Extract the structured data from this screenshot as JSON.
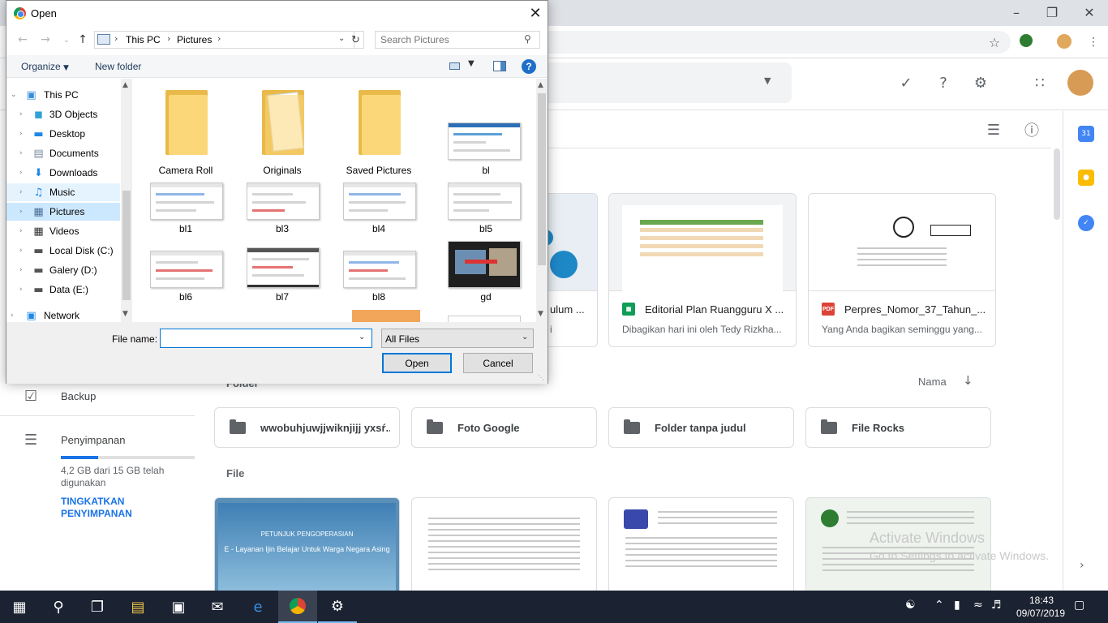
{
  "dialog": {
    "title": "Open",
    "breadcrumbs": [
      "This PC",
      "Pictures"
    ],
    "search_placeholder": "Search Pictures",
    "organize_label": "Organize",
    "new_folder_label": "New folder",
    "help_label": "?",
    "nav_tree": [
      {
        "label": "This PC",
        "icon": "monitor-icon",
        "expanded": true
      },
      {
        "label": "3D Objects",
        "icon": "cube-icon"
      },
      {
        "label": "Desktop",
        "icon": "desktop-icon"
      },
      {
        "label": "Documents",
        "icon": "documents-icon"
      },
      {
        "label": "Downloads",
        "icon": "download-arrow-icon"
      },
      {
        "label": "Music",
        "icon": "music-note-icon"
      },
      {
        "label": "Pictures",
        "icon": "pictures-icon",
        "selected": true
      },
      {
        "label": "Videos",
        "icon": "film-icon"
      },
      {
        "label": "Local Disk (C:)",
        "icon": "drive-icon"
      },
      {
        "label": "Galery (D:)",
        "icon": "drive-icon"
      },
      {
        "label": "Data (E:)",
        "icon": "drive-icon"
      },
      {
        "label": "Network",
        "icon": "network-icon"
      }
    ],
    "files": [
      {
        "name": "Camera Roll",
        "kind": "folder"
      },
      {
        "name": "Originals",
        "kind": "folder"
      },
      {
        "name": "Saved Pictures",
        "kind": "folder"
      },
      {
        "name": "bl",
        "kind": "image"
      },
      {
        "name": "bl1",
        "kind": "image"
      },
      {
        "name": "bl3",
        "kind": "image"
      },
      {
        "name": "bl4",
        "kind": "image"
      },
      {
        "name": "bl5",
        "kind": "image"
      },
      {
        "name": "bl6",
        "kind": "image"
      },
      {
        "name": "bl7",
        "kind": "image"
      },
      {
        "name": "bl8",
        "kind": "image"
      },
      {
        "name": "gd",
        "kind": "image"
      }
    ],
    "file_name_label": "File name:",
    "file_name_value": "",
    "file_type_value": "All Files",
    "open_label": "Open",
    "cancel_label": "Cancel"
  },
  "drive": {
    "quick_cards": [
      {
        "title": "ulum ...",
        "subtitle": "i",
        "type": ""
      },
      {
        "title": "Editorial Plan Ruangguru X ...",
        "subtitle": "Dibagikan hari ini oleh Tedy Rizkha...",
        "type": "sheets",
        "color": "#0f9d58"
      },
      {
        "title": "Perpres_Nomor_37_Tahun_...",
        "subtitle": "Yang Anda bagikan seminggu yang...",
        "type": "PDF",
        "color": "#db4437"
      }
    ],
    "folder_section_label": "Folder",
    "sort_label": "Nama",
    "folders": [
      "wwobuhjuwjjwiknjijj yxsŕ...",
      "Foto Google",
      "Folder tanpa judul",
      "File Rocks"
    ],
    "file_section_label": "File",
    "sidebar": {
      "backup_label": "Backup",
      "storage_label": "Penyimpanan",
      "storage_text": "4,2 GB dari 15 GB telah digunakan",
      "storage_fraction": 0.28,
      "upgrade_label": "TINGKATKAN PENYIMPANAN"
    },
    "file_card_texts": [
      "PETUNJUK PENGOPERASIAN",
      "E - Layanan Ijin Belajar Untuk Warga Negara Asing"
    ]
  },
  "watermark": {
    "line1": "Activate Windows",
    "line2": "Go to Settings to activate Windows."
  },
  "taskbar": {
    "time": "18:43",
    "date": "09/07/2019"
  },
  "colors": {
    "accent": "#1a73e8",
    "dialog_selection": "#cce8ff",
    "taskbar": "#1b2231",
    "folder_yellow": "#fcd779"
  }
}
